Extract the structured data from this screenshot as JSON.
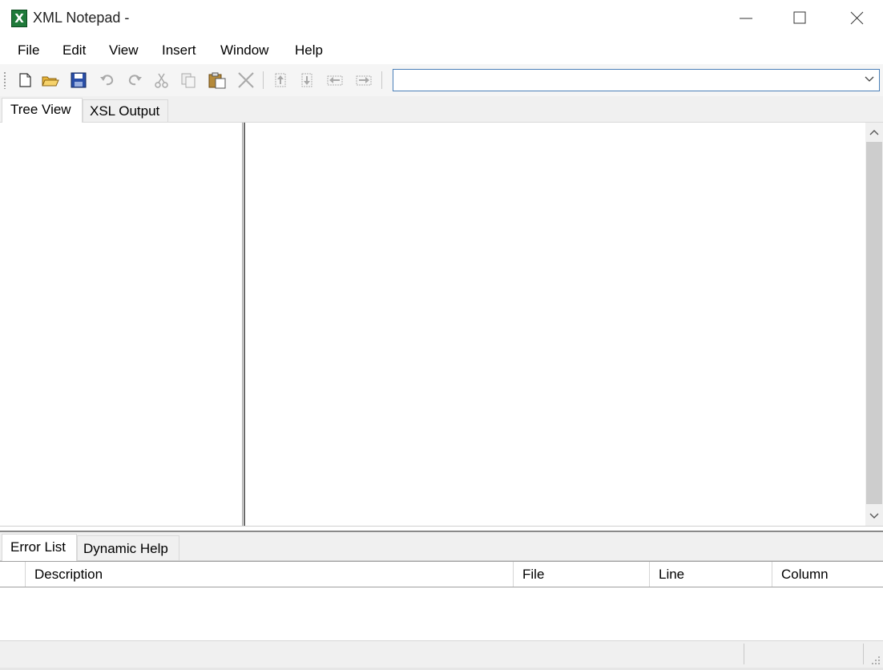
{
  "window": {
    "title": "XML Notepad -",
    "icon": "xml-notepad-app-icon",
    "controls": [
      "minimize-icon",
      "maximize-icon",
      "close-icon"
    ]
  },
  "menu": {
    "items": [
      "File",
      "Edit",
      "View",
      "Insert",
      "Window",
      "Help"
    ]
  },
  "toolbar": {
    "buttons": [
      "new-file-icon",
      "open-folder-icon",
      "save-icon",
      "undo-icon",
      "redo-icon",
      "cut-icon",
      "copy-icon",
      "paste-icon",
      "delete-icon",
      "nudge-up-icon",
      "nudge-down-icon",
      "nudge-left-icon",
      "nudge-right-icon"
    ],
    "location_combo_value": ""
  },
  "top_tabs": [
    "Tree View",
    "XSL Output"
  ],
  "bottom_tabs": [
    "Error List",
    "Dynamic Help"
  ],
  "error_list": {
    "columns": [
      "Description",
      "File",
      "Line",
      "Column"
    ],
    "rows": []
  },
  "colors": {
    "accent_border": "#4a7fb8",
    "scroll_thumb": "#cdcdcd",
    "app_icon_green": "#1f7a3a"
  }
}
